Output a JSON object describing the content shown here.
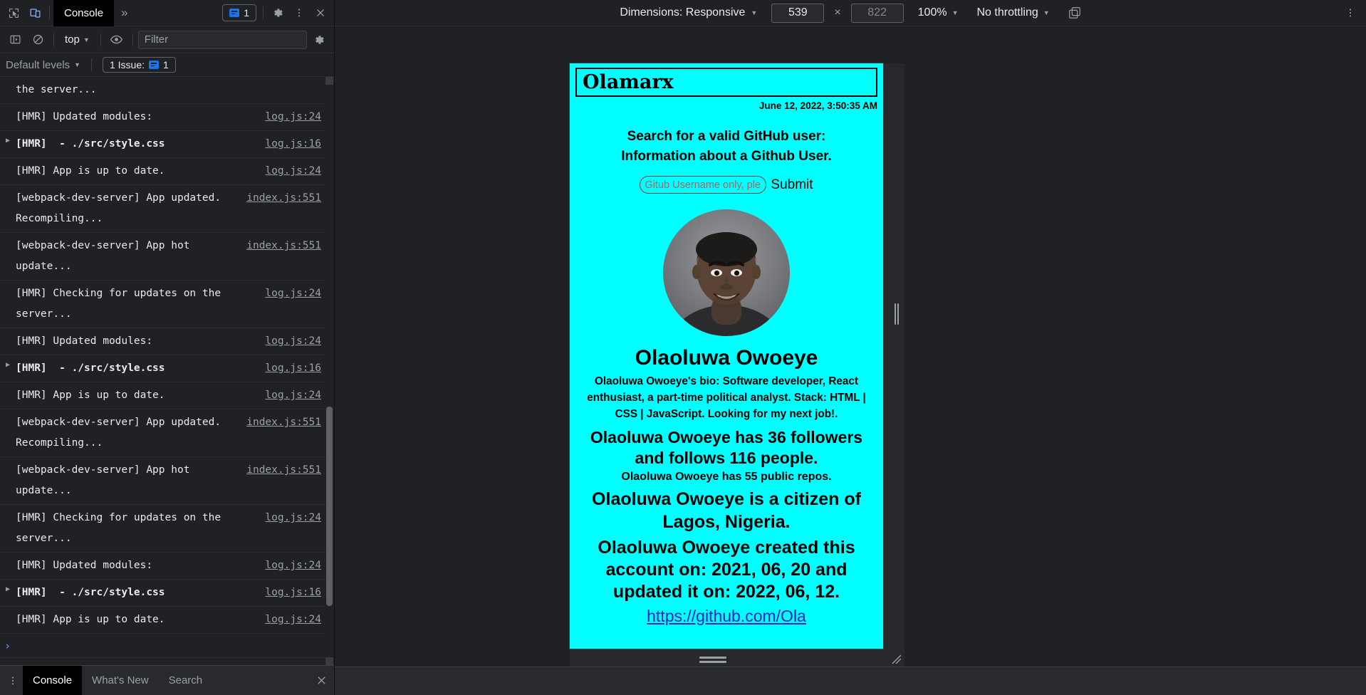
{
  "devtools": {
    "toolbar": {
      "inspect_icon": "inspect-cursor-icon",
      "device_toggle_icon": "device-toolbar-icon",
      "tabs": [
        {
          "label": "Console",
          "active": true
        }
      ],
      "more_tabs_label": "»",
      "issues_count": "1",
      "settings_icon": "gear-icon",
      "kebab_icon": "more-vertical-icon",
      "close_icon": "close-icon"
    },
    "filterbar": {
      "sidebar_toggle_icon": "console-sidebar-icon",
      "clear_icon": "clear-console-icon",
      "context_label": "top",
      "eye_icon": "live-expression-eye-icon",
      "filter_value": "",
      "filter_placeholder": "Filter",
      "settings_icon": "console-settings-gear-icon"
    },
    "levelsbar": {
      "levels_label": "Default levels",
      "issue_chip_label": "1 Issue:",
      "issue_chip_count": "1"
    },
    "messages": [
      {
        "arrow": false,
        "bold": false,
        "text": "the server...",
        "source": "",
        "partial": true
      },
      {
        "arrow": false,
        "bold": false,
        "text": "[HMR] Updated modules:",
        "source": "log.js:24"
      },
      {
        "arrow": true,
        "bold": true,
        "text": "[HMR]  - ./src/style.css",
        "source": "log.js:16"
      },
      {
        "arrow": false,
        "bold": false,
        "text": "[HMR] App is up to date.",
        "source": "log.js:24"
      },
      {
        "arrow": false,
        "bold": false,
        "text": "[webpack-dev-server] App updated. Recompiling...",
        "source": "index.js:551"
      },
      {
        "arrow": false,
        "bold": false,
        "text": "[webpack-dev-server] App hot update...",
        "source": "index.js:551"
      },
      {
        "arrow": false,
        "bold": false,
        "text": "[HMR] Checking for updates on the server...",
        "source": "log.js:24"
      },
      {
        "arrow": false,
        "bold": false,
        "text": "[HMR] Updated modules:",
        "source": "log.js:24"
      },
      {
        "arrow": true,
        "bold": true,
        "text": "[HMR]  - ./src/style.css",
        "source": "log.js:16"
      },
      {
        "arrow": false,
        "bold": false,
        "text": "[HMR] App is up to date.",
        "source": "log.js:24"
      },
      {
        "arrow": false,
        "bold": false,
        "text": "[webpack-dev-server] App updated. Recompiling...",
        "source": "index.js:551"
      },
      {
        "arrow": false,
        "bold": false,
        "text": "[webpack-dev-server] App hot update...",
        "source": "index.js:551"
      },
      {
        "arrow": false,
        "bold": false,
        "text": "[HMR] Checking for updates on the server...",
        "source": "log.js:24"
      },
      {
        "arrow": false,
        "bold": false,
        "text": "[HMR] Updated modules:",
        "source": "log.js:24"
      },
      {
        "arrow": true,
        "bold": true,
        "text": "[HMR]  - ./src/style.css",
        "source": "log.js:16"
      },
      {
        "arrow": false,
        "bold": false,
        "text": "[HMR] App is up to date.",
        "source": "log.js:24"
      }
    ],
    "prompt_symbol": "›",
    "drawer": {
      "kebab_icon": "more-vertical-icon",
      "tabs": [
        {
          "label": "Console",
          "active": true
        },
        {
          "label": "What's New",
          "active": false
        },
        {
          "label": "Search",
          "active": false
        }
      ],
      "close_icon": "close-drawer-icon"
    }
  },
  "emulation": {
    "dimensions_label": "Dimensions: Responsive",
    "width_value": "539",
    "height_value": "",
    "height_placeholder": "822",
    "times_symbol": "×",
    "zoom_label": "100%",
    "throttling_label": "No throttling",
    "rotate_icon": "rotate-device-icon",
    "kebab_icon": "more-vertical-icon"
  },
  "page": {
    "background_color": "#00ffff",
    "header_title": "Olamarx",
    "date": "June 12, 2022, 3:50:35 AM",
    "lead_line1": "Search for a valid GitHub user:",
    "lead_line2": "Information about a Github User.",
    "search_value": "",
    "search_placeholder": "Gitub Username only, please",
    "submit_label": "Submit",
    "avatar_alt": "user-avatar",
    "name": "Olaoluwa Owoeye",
    "bio": "Olaoluwa Owoeye's bio: Software developer, React enthusiast, a part-time political analyst. Stack: HTML | CSS | JavaScript. Looking for my next job!.",
    "followers_line": "Olaoluwa Owoeye has 36 followers and follows 116 people.",
    "repos_line": "Olaoluwa Owoeye has 55 public repos.",
    "location_line": "Olaoluwa Owoeye is a citizen of Lagos, Nigeria.",
    "dates_line": "Olaoluwa Owoeye created this account on: 2021, 06, 20 and updated it on: 2022, 06, 12.",
    "profile_link": "https://github.com/Ola",
    "followers_count": "36",
    "following_count": "116",
    "public_repos": "55",
    "location": "Lagos, Nigeria",
    "created_on": "2021, 06, 20",
    "updated_on": "2022, 06, 12"
  }
}
